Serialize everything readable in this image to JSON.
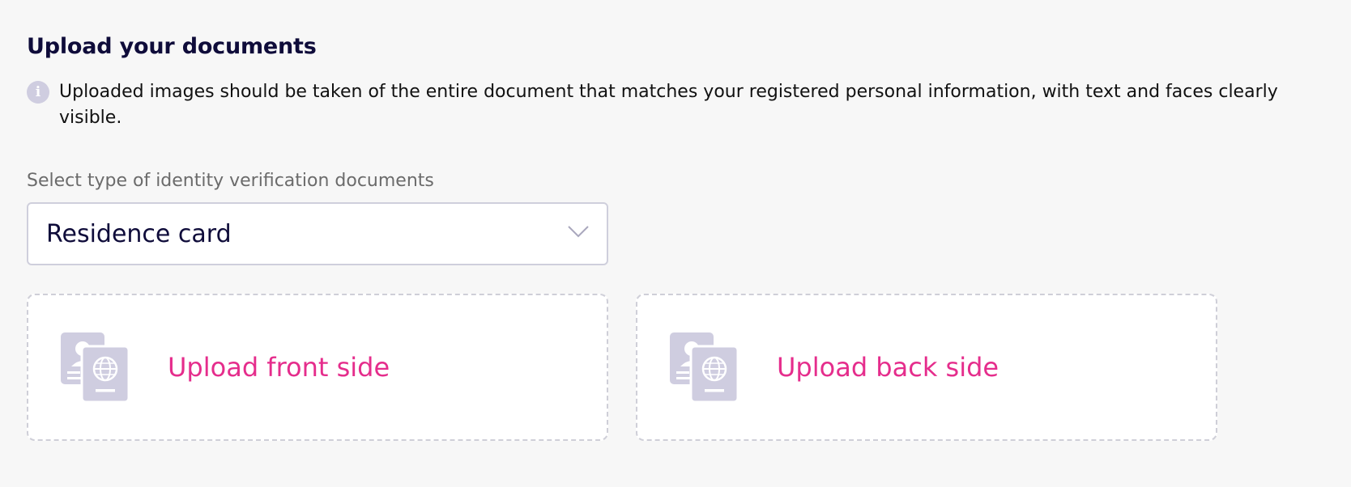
{
  "section": {
    "title": "Upload your documents",
    "info_icon": "info-icon",
    "info_text": "Uploaded images should be taken of the entire document that matches your registered personal information, with text and faces clearly visible."
  },
  "document_type": {
    "label": "Select type of identity verification documents",
    "selected": "Residence card",
    "dropdown_icon": "chevron-down-icon"
  },
  "uploads": {
    "front": {
      "label": "Upload front side",
      "icon": "id-passport-icon"
    },
    "back": {
      "label": "Upload back side",
      "icon": "id-passport-icon"
    }
  },
  "colors": {
    "title": "#0f0c3a",
    "accent": "#e52d8c",
    "icon": "#cfcde0",
    "border": "#cfcfdc"
  }
}
